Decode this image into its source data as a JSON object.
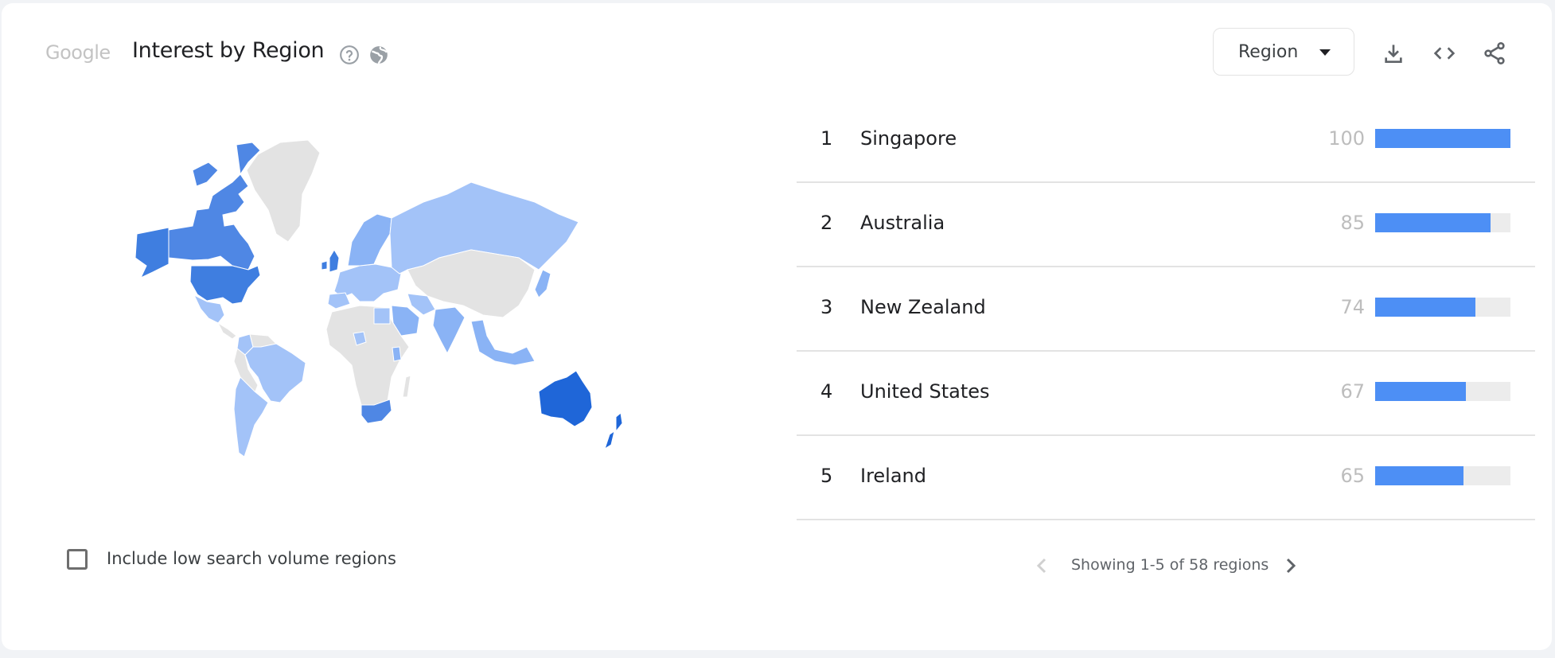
{
  "header": {
    "logo_text": "Google",
    "title": "Interest by Region",
    "help_icon": "help-circle-icon",
    "globe_icon": "globe-icon"
  },
  "toolbar": {
    "resolution_select": {
      "selected": "Region"
    },
    "download_icon": "download-icon",
    "embed_icon": "code-embed-icon",
    "share_icon": "share-icon"
  },
  "colors": {
    "accent": "#4d8ff5",
    "track": "#ececec",
    "map_none": "#e3e3e3",
    "map_shades": [
      "#a3c3f8",
      "#8ab3f5",
      "#4f87e4",
      "#3f7ee0",
      "#1f66d8"
    ]
  },
  "map": {
    "shading": [
      {
        "region": "Australia",
        "shade": 4
      },
      {
        "region": "New Zealand",
        "shade": 4
      },
      {
        "region": "United States",
        "shade": 3
      },
      {
        "region": "Canada",
        "shade": 2
      },
      {
        "region": "United Kingdom",
        "shade": 3
      },
      {
        "region": "Ireland",
        "shade": 3
      },
      {
        "region": "South Africa",
        "shade": 2
      },
      {
        "region": "Russia",
        "shade": 0
      },
      {
        "region": "Europe",
        "shade": 0
      },
      {
        "region": "Scandinavia",
        "shade": 1
      },
      {
        "region": "Mexico",
        "shade": 0
      },
      {
        "region": "Brazil",
        "shade": 0
      },
      {
        "region": "Argentina",
        "shade": 0
      },
      {
        "region": "Colombia",
        "shade": 0
      },
      {
        "region": "India",
        "shade": 1
      },
      {
        "region": "Saudi Arabia",
        "shade": 1
      },
      {
        "region": "Iran",
        "shade": 0
      },
      {
        "region": "Egypt",
        "shade": 0
      },
      {
        "region": "Nigeria",
        "shade": 0
      },
      {
        "region": "Kenya",
        "shade": 1
      },
      {
        "region": "Southeast Asia",
        "shade": 1
      },
      {
        "region": "Japan",
        "shade": 1
      },
      {
        "region": "Greenland",
        "shade": null
      },
      {
        "region": "China",
        "shade": null
      },
      {
        "region": "Central Asia",
        "shade": null
      },
      {
        "region": "Africa (other)",
        "shade": null
      },
      {
        "region": "South America (other)",
        "shade": null
      }
    ]
  },
  "list": {
    "rows": [
      {
        "rank": "1",
        "name": "Singapore",
        "value": "100",
        "pct": 100
      },
      {
        "rank": "2",
        "name": "Australia",
        "value": "85",
        "pct": 85
      },
      {
        "rank": "3",
        "name": "New Zealand",
        "value": "74",
        "pct": 74
      },
      {
        "rank": "4",
        "name": "United States",
        "value": "67",
        "pct": 67
      },
      {
        "rank": "5",
        "name": "Ireland",
        "value": "65",
        "pct": 65
      }
    ]
  },
  "pagination": {
    "text": "Showing 1-5 of 58 regions",
    "prev_icon": "chevron-left-icon",
    "next_icon": "chevron-right-icon",
    "prev_enabled": false,
    "next_enabled": true
  },
  "options": {
    "low_volume_label": "Include low search volume regions",
    "low_volume_checked": false
  }
}
